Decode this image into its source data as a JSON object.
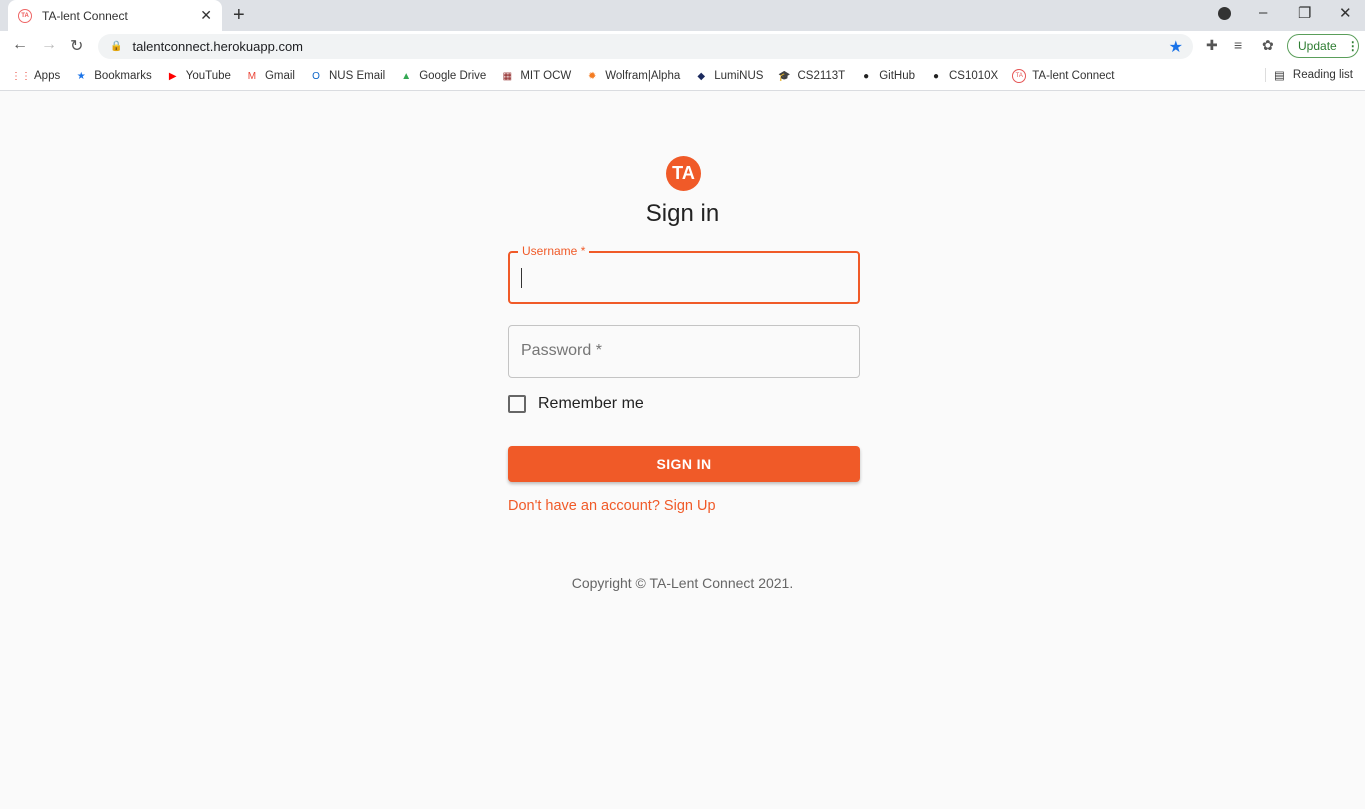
{
  "browser": {
    "tab_title": "TA-lent Connect",
    "url": "talentconnect.herokuapp.com",
    "update_label": "Update",
    "reading_list": "Reading list",
    "bookmarks": [
      {
        "label": "Apps",
        "icon": "apps-grid-icon",
        "color": "#ea4335"
      },
      {
        "label": "Bookmarks",
        "icon": "star-icon",
        "color": "#1a73e8"
      },
      {
        "label": "YouTube",
        "icon": "youtube-icon",
        "color": "#ff0000"
      },
      {
        "label": "Gmail",
        "icon": "gmail-icon",
        "color": "#ea4335"
      },
      {
        "label": "NUS Email",
        "icon": "outlook-icon",
        "color": "#0a64c8"
      },
      {
        "label": "Google Drive",
        "icon": "drive-icon",
        "color": "#34a853"
      },
      {
        "label": "MIT OCW",
        "icon": "mit-icon",
        "color": "#8a1c1c"
      },
      {
        "label": "Wolfram|Alpha",
        "icon": "wolfram-icon",
        "color": "#f47b20"
      },
      {
        "label": "LumiNUS",
        "icon": "luminus-icon",
        "color": "#1b2a5e"
      },
      {
        "label": "CS2113T",
        "icon": "graduation-cap-icon",
        "color": "#1a73e8"
      },
      {
        "label": "GitHub",
        "icon": "github-icon",
        "color": "#222222"
      },
      {
        "label": "CS1010X",
        "icon": "cs1010x-icon",
        "color": "#222222"
      },
      {
        "label": "TA-lent Connect",
        "icon": "ta-favicon-icon",
        "color": "#e55555"
      }
    ]
  },
  "page": {
    "logo_text": "TA",
    "title": "Sign in",
    "username_label": "Username *",
    "password_placeholder": "Password *",
    "remember_label": "Remember me",
    "signin_button": "SIGN IN",
    "signup_link": "Don't have an account? Sign Up",
    "copyright": "Copyright © TA-Lent Connect 2021."
  },
  "colors": {
    "accent": "#f05a28"
  }
}
